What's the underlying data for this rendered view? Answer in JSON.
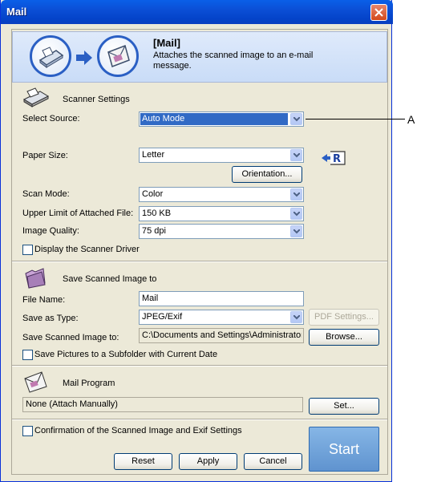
{
  "window": {
    "title": "Mail"
  },
  "banner": {
    "title": "[Mail]",
    "description": "Attaches the scanned image to an e-mail message."
  },
  "scanner": {
    "section_title": "Scanner Settings",
    "select_source": {
      "label": "Select Source:",
      "value": "Auto Mode"
    },
    "paper_size": {
      "label": "Paper Size:",
      "value": "Letter"
    },
    "orientation_button": "Orientation...",
    "scan_mode": {
      "label": "Scan Mode:",
      "value": "Color"
    },
    "upper_limit": {
      "label": "Upper Limit of Attached File:",
      "value": "150 KB"
    },
    "image_quality": {
      "label": "Image Quality:",
      "value": "75 dpi"
    },
    "display_driver": {
      "label": "Display the Scanner Driver",
      "checked": false
    }
  },
  "save": {
    "section_title": "Save Scanned Image to",
    "file_name": {
      "label": "File Name:",
      "value": "Mail"
    },
    "save_as_type": {
      "label": "Save as Type:",
      "value": "JPEG/Exif"
    },
    "pdf_settings_button": "PDF Settings...",
    "save_to": {
      "label": "Save Scanned Image to:",
      "value": "C:\\Documents and Settings\\Administrator"
    },
    "browse_button": "Browse...",
    "subfolder": {
      "label": "Save Pictures to a Subfolder with Current Date",
      "checked": false
    }
  },
  "mail": {
    "section_title": "Mail Program",
    "program_value": "None (Attach Manually)",
    "set_button": "Set..."
  },
  "footer": {
    "confirmation": {
      "label": "Confirmation of the Scanned Image and Exif Settings",
      "checked": false
    },
    "reset_button": "Reset",
    "apply_button": "Apply",
    "cancel_button": "Cancel",
    "start_button": "Start"
  },
  "callout": {
    "label": "A"
  },
  "colors": {
    "title_bar": "#0b4fd6",
    "selection": "#316ac5",
    "start_button": "#6fa3db"
  }
}
